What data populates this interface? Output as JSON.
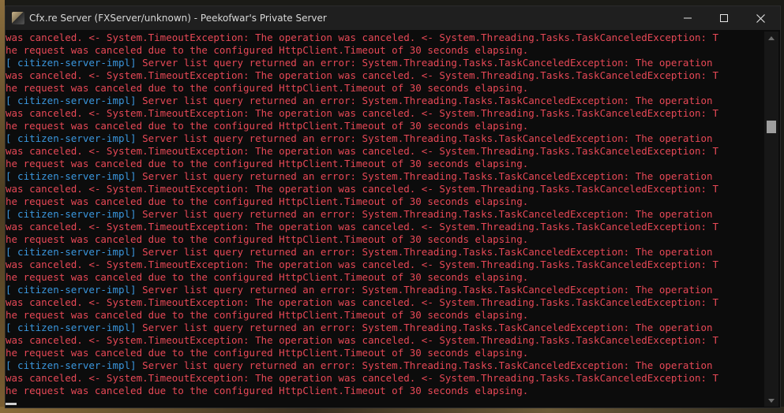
{
  "window": {
    "title": "Cfx.re Server (FXServer/unknown) - Peekofwar's Private Server",
    "controls": {
      "minimize_icon": "minimize-icon",
      "maximize_icon": "maximize-icon",
      "close_icon": "close-icon"
    }
  },
  "colors": {
    "console_bg": "#0c0c0c",
    "error_text": "#e74856",
    "tag_text": "#3a96dd",
    "titlebar_bg": "#1f1f1f"
  },
  "console": {
    "lines": [
      {
        "tag": "",
        "text": "was canceled. <- System.TimeoutException: The operation was canceled. <- System.Threading.Tasks.TaskCanceledException: T"
      },
      {
        "tag": "",
        "text": "he request was canceled due to the configured HttpClient.Timeout of 30 seconds elapsing."
      },
      {
        "tag": "[ citizen-server-impl]",
        "text": " Server list query returned an error: System.Threading.Tasks.TaskCanceledException: The operation"
      },
      {
        "tag": "",
        "text": "was canceled. <- System.TimeoutException: The operation was canceled. <- System.Threading.Tasks.TaskCanceledException: T"
      },
      {
        "tag": "",
        "text": "he request was canceled due to the configured HttpClient.Timeout of 30 seconds elapsing."
      },
      {
        "tag": "[ citizen-server-impl]",
        "text": " Server list query returned an error: System.Threading.Tasks.TaskCanceledException: The operation"
      },
      {
        "tag": "",
        "text": "was canceled. <- System.TimeoutException: The operation was canceled. <- System.Threading.Tasks.TaskCanceledException: T"
      },
      {
        "tag": "",
        "text": "he request was canceled due to the configured HttpClient.Timeout of 30 seconds elapsing."
      },
      {
        "tag": "[ citizen-server-impl]",
        "text": " Server list query returned an error: System.Threading.Tasks.TaskCanceledException: The operation"
      },
      {
        "tag": "",
        "text": "was canceled. <- System.TimeoutException: The operation was canceled. <- System.Threading.Tasks.TaskCanceledException: T"
      },
      {
        "tag": "",
        "text": "he request was canceled due to the configured HttpClient.Timeout of 30 seconds elapsing."
      },
      {
        "tag": "[ citizen-server-impl]",
        "text": " Server list query returned an error: System.Threading.Tasks.TaskCanceledException: The operation"
      },
      {
        "tag": "",
        "text": "was canceled. <- System.TimeoutException: The operation was canceled. <- System.Threading.Tasks.TaskCanceledException: T"
      },
      {
        "tag": "",
        "text": "he request was canceled due to the configured HttpClient.Timeout of 30 seconds elapsing."
      },
      {
        "tag": "[ citizen-server-impl]",
        "text": " Server list query returned an error: System.Threading.Tasks.TaskCanceledException: The operation"
      },
      {
        "tag": "",
        "text": "was canceled. <- System.TimeoutException: The operation was canceled. <- System.Threading.Tasks.TaskCanceledException: T"
      },
      {
        "tag": "",
        "text": "he request was canceled due to the configured HttpClient.Timeout of 30 seconds elapsing."
      },
      {
        "tag": "[ citizen-server-impl]",
        "text": " Server list query returned an error: System.Threading.Tasks.TaskCanceledException: The operation"
      },
      {
        "tag": "",
        "text": "was canceled. <- System.TimeoutException: The operation was canceled. <- System.Threading.Tasks.TaskCanceledException: T"
      },
      {
        "tag": "",
        "text": "he request was canceled due to the configured HttpClient.Timeout of 30 seconds elapsing."
      },
      {
        "tag": "[ citizen-server-impl]",
        "text": " Server list query returned an error: System.Threading.Tasks.TaskCanceledException: The operation"
      },
      {
        "tag": "",
        "text": "was canceled. <- System.TimeoutException: The operation was canceled. <- System.Threading.Tasks.TaskCanceledException: T"
      },
      {
        "tag": "",
        "text": "he request was canceled due to the configured HttpClient.Timeout of 30 seconds elapsing."
      },
      {
        "tag": "[ citizen-server-impl]",
        "text": " Server list query returned an error: System.Threading.Tasks.TaskCanceledException: The operation"
      },
      {
        "tag": "",
        "text": "was canceled. <- System.TimeoutException: The operation was canceled. <- System.Threading.Tasks.TaskCanceledException: T"
      },
      {
        "tag": "",
        "text": "he request was canceled due to the configured HttpClient.Timeout of 30 seconds elapsing."
      },
      {
        "tag": "[ citizen-server-impl]",
        "text": " Server list query returned an error: System.Threading.Tasks.TaskCanceledException: The operation"
      },
      {
        "tag": "",
        "text": "was canceled. <- System.TimeoutException: The operation was canceled. <- System.Threading.Tasks.TaskCanceledException: T"
      },
      {
        "tag": "",
        "text": "he request was canceled due to the configured HttpClient.Timeout of 30 seconds elapsing."
      }
    ]
  },
  "scrollbar": {
    "up_icon": "scroll-up-arrow-icon",
    "down_icon": "scroll-down-arrow-icon"
  }
}
